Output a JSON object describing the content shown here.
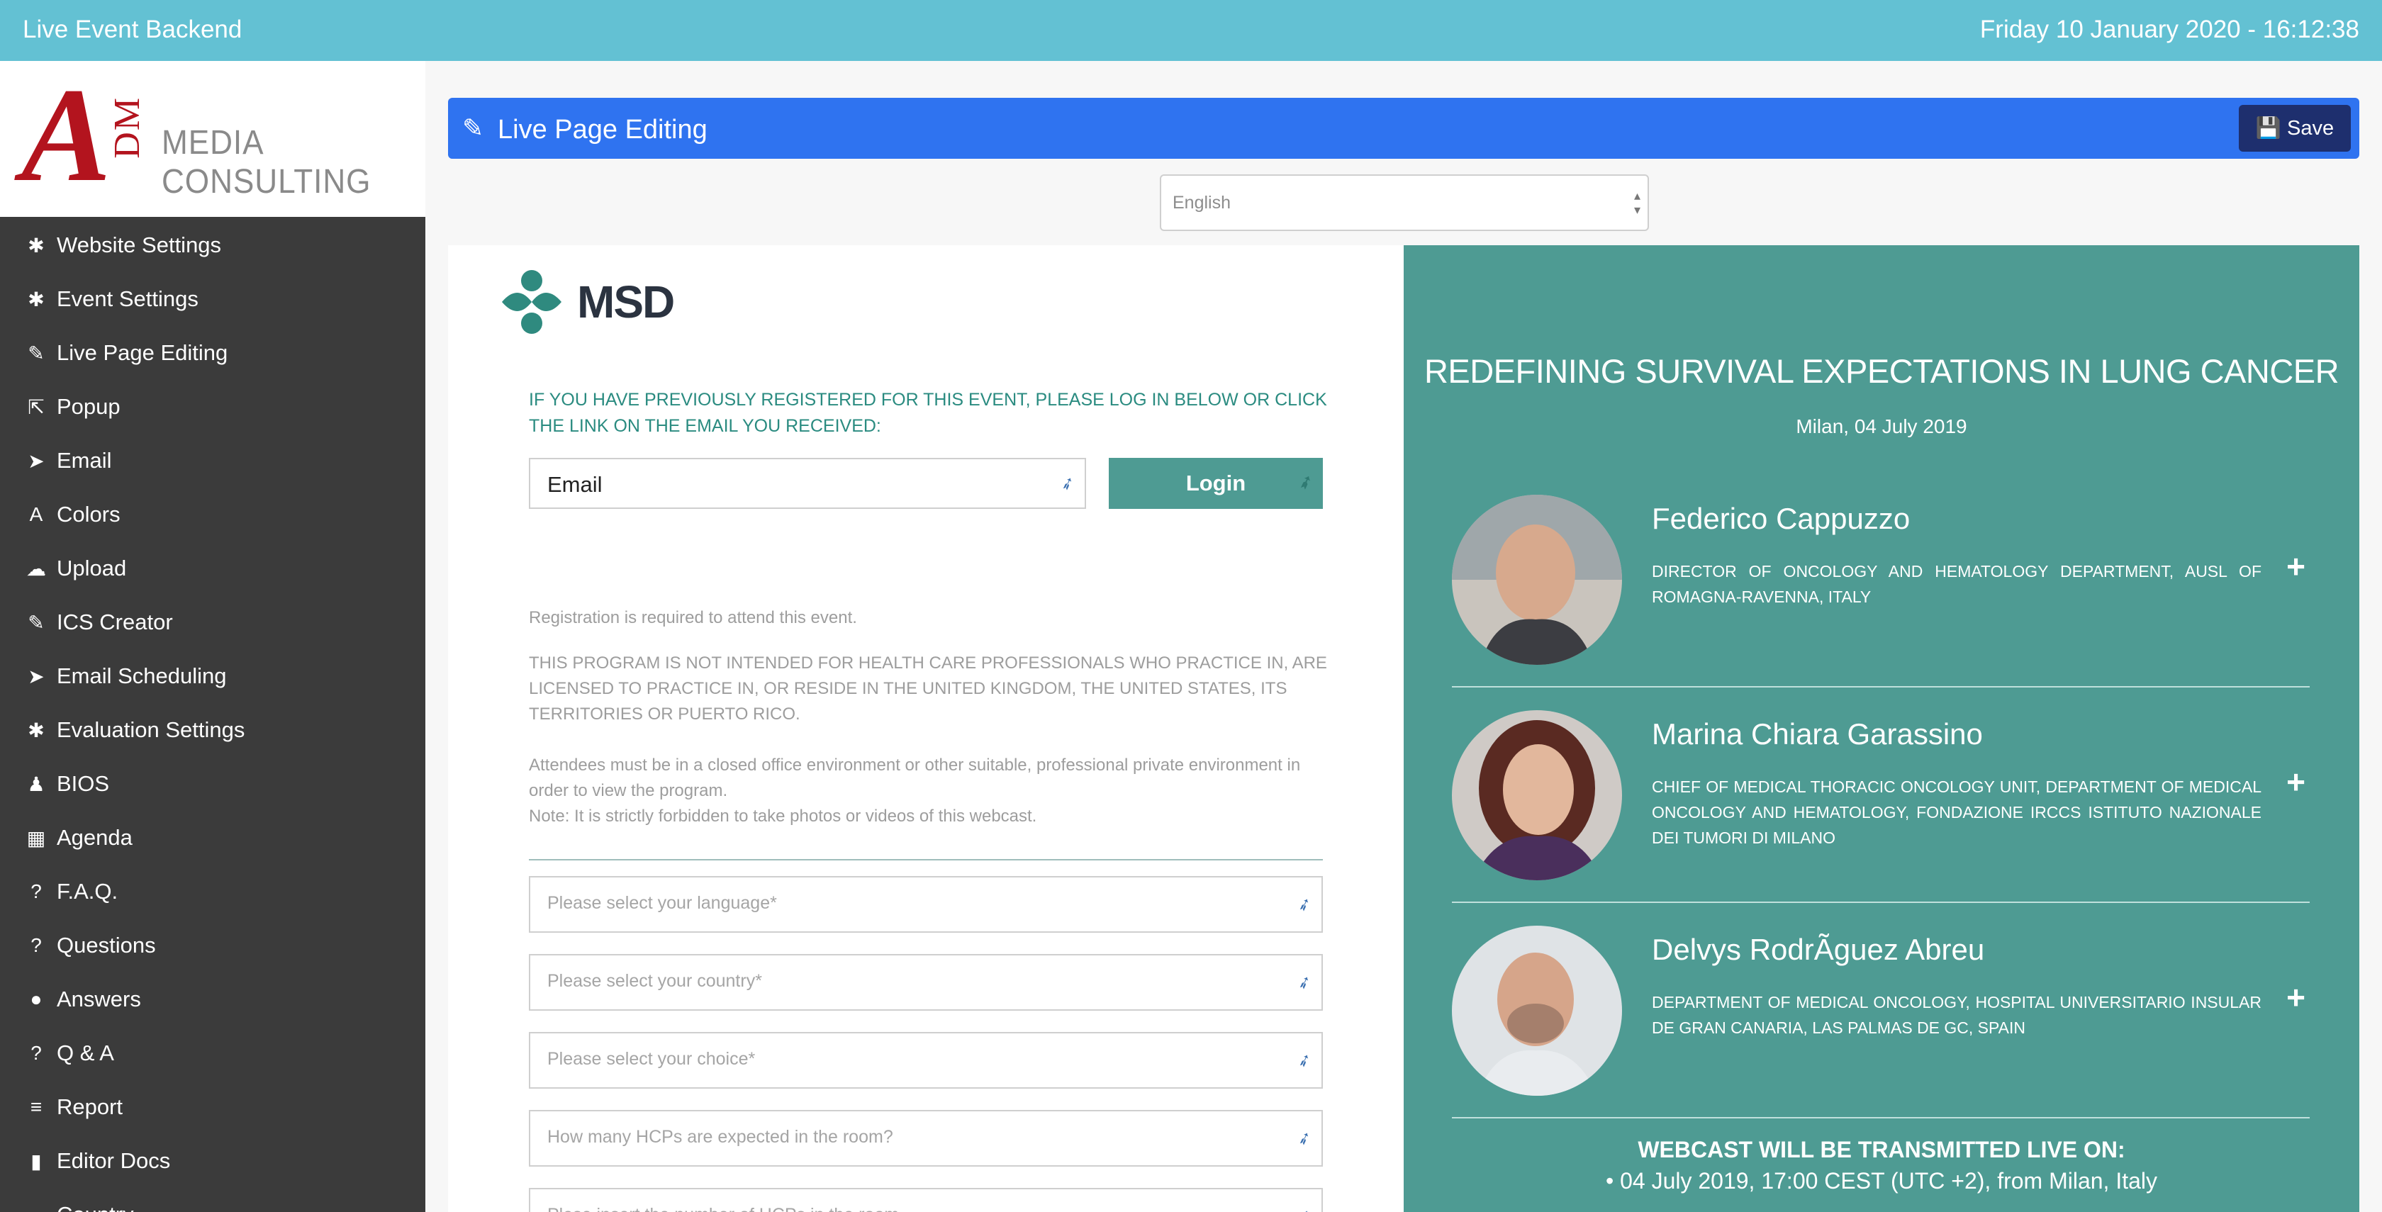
{
  "topbar": {
    "app_title": "Live Event Backend",
    "datetime": "Friday 10 January 2020 - 16:12:38"
  },
  "logo": {
    "letter": "A",
    "monogram": "DM",
    "company": "MEDIA CONSULTING"
  },
  "sidebar": {
    "items": [
      {
        "label": "Website Settings",
        "icon": "gear-icon",
        "glyph": "✱"
      },
      {
        "label": "Event Settings",
        "icon": "gear-icon",
        "glyph": "✱"
      },
      {
        "label": "Live Page Editing",
        "icon": "edit-icon",
        "glyph": "✎"
      },
      {
        "label": "Popup",
        "icon": "external-link-icon",
        "glyph": "⇱"
      },
      {
        "label": "Email",
        "icon": "paper-plane-icon",
        "glyph": "➤"
      },
      {
        "label": "Colors",
        "icon": "font-icon",
        "glyph": "A"
      },
      {
        "label": "Upload",
        "icon": "cloud-upload-icon",
        "glyph": "☁"
      },
      {
        "label": "ICS Creator",
        "icon": "paperclip-icon",
        "glyph": "✎"
      },
      {
        "label": "Email Scheduling",
        "icon": "paper-plane-icon",
        "glyph": "➤"
      },
      {
        "label": "Evaluation Settings",
        "icon": "gear-icon",
        "glyph": "✱"
      },
      {
        "label": "BIOS",
        "icon": "user-icon",
        "glyph": "♟"
      },
      {
        "label": "Agenda",
        "icon": "calendar-icon",
        "glyph": "▦"
      },
      {
        "label": "F.A.Q.",
        "icon": "question-circle-icon",
        "glyph": "?"
      },
      {
        "label": "Questions",
        "icon": "question-icon",
        "glyph": "?"
      },
      {
        "label": "Answers",
        "icon": "comment-icon",
        "glyph": "●"
      },
      {
        "label": "Q & A",
        "icon": "question-circle-icon",
        "glyph": "?"
      },
      {
        "label": "Report",
        "icon": "database-icon",
        "glyph": "≡"
      },
      {
        "label": "Editor Docs",
        "icon": "book-icon",
        "glyph": "▮"
      },
      {
        "label": "Country",
        "icon": "flag-icon",
        "glyph": "▬"
      }
    ]
  },
  "header": {
    "title": "Live Page Editing",
    "save_label": "Save"
  },
  "language_select": {
    "selected": "English"
  },
  "preview": {
    "brand": "MSD",
    "login_note": "IF YOU HAVE PREVIOUSLY REGISTERED FOR THIS EVENT, PLEASE LOG IN BELOW OR CLICK THE LINK ON THE EMAIL YOU RECEIVED:",
    "email_placeholder": "Email",
    "login_label": "Login",
    "registration_note": "Registration is required to attend this event.",
    "disclaimer": "THIS PROGRAM IS NOT INTENDED FOR HEALTH CARE PROFESSIONALS WHO PRACTICE IN, ARE LICENSED TO PRACTICE IN, OR RESIDE IN THE UNITED KINGDOM, THE UNITED STATES, ITS TERRITORIES OR PUERTO RICO.",
    "attendees_note": "Attendees must be in a closed office environment or other suitable, professional private environment in order to view the program.",
    "forbidden_note": "Note: It is strictly forbidden to take photos or videos of this webcast.",
    "fields": [
      "Please select your language*",
      "Please select your country*",
      "Please select your choice*",
      "How many HCPs are expected in the room?",
      "Plese insert the number of HCPs in the room"
    ]
  },
  "event": {
    "title": "REDEFINING SURVIVAL EXPECTATIONS IN LUNG CANCER",
    "location_date": "Milan, 04 July 2019",
    "speakers": [
      {
        "name": "Federico Cappuzzo",
        "role": "DIRECTOR OF ONCOLOGY AND HEMATOLOGY DEPARTMENT, AUSL OF ROMAGNA-RAVENNA, ITALY"
      },
      {
        "name": "Marina Chiara Garassino",
        "role": "CHIEF OF MEDICAL THORACIC ONCOLOGY UNIT, DEPARTMENT OF MEDICAL ONCOLOGY AND HEMATOLOGY, FONDAZIONE IRCCS ISTITUTO NAZIONALE DEI TUMORI DI MILANO"
      },
      {
        "name": "Delvys RodrÃguez Abreu",
        "role": "DEPARTMENT OF MEDICAL ONCOLOGY, HOSPITAL UNIVERSITARIO INSULAR DE GRAN CANARIA, LAS PALMAS DE GC, SPAIN"
      }
    ],
    "webcast_heading": "WEBCAST WILL BE TRANSMITTED LIVE ON:",
    "webcast_line": "• 04 July 2019, 17:00 CEST (UTC +2), from Milan, Italy"
  },
  "colors": {
    "topbar": "#63c1d3",
    "sidebar": "#3b3b3b",
    "header_bar": "#2f73f0",
    "save_button": "#1e2f6e",
    "teal": "#4e9b93",
    "logo_red": "#b3141e"
  }
}
